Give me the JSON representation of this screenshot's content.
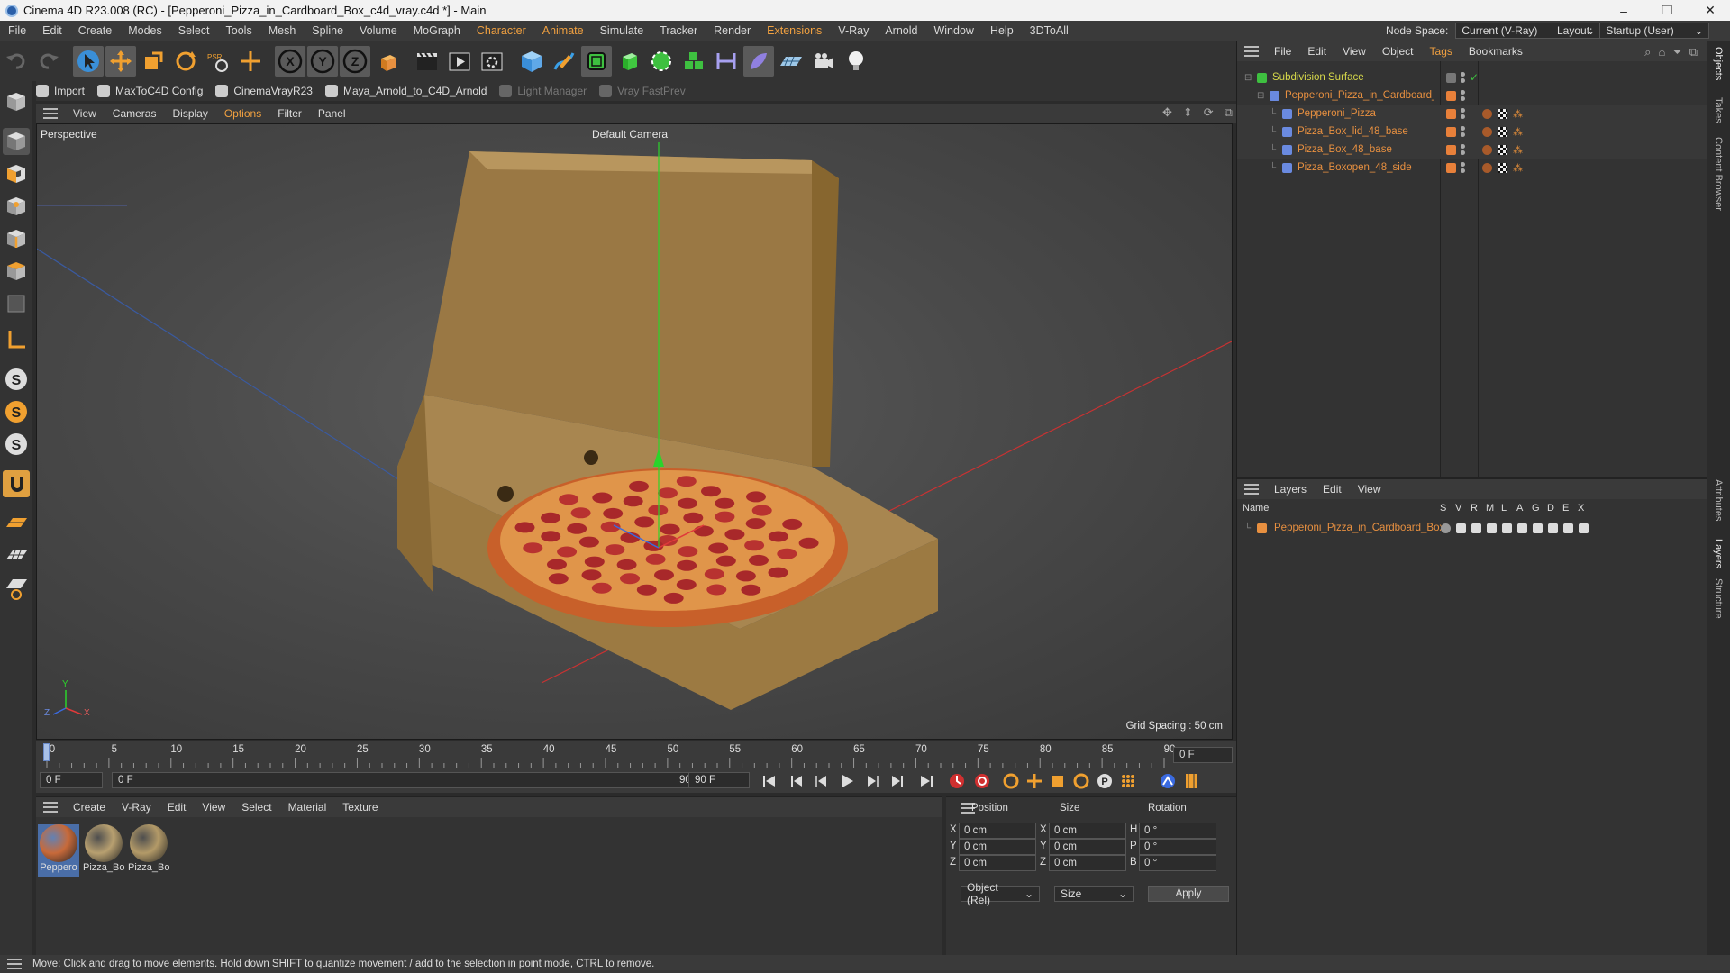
{
  "window": {
    "title": "Cinema 4D R23.008 (RC) - [Pepperoni_Pizza_in_Cardboard_Box_c4d_vray.c4d *] - Main",
    "controls": [
      "–",
      "❐",
      "✕"
    ]
  },
  "menu": [
    "File",
    "Edit",
    "Create",
    "Modes",
    "Select",
    "Tools",
    "Mesh",
    "Spline",
    "Volume",
    "MoGraph",
    "Character",
    "Animate",
    "Simulate",
    "Tracker",
    "Render",
    "Extensions",
    "V-Ray",
    "Arnold",
    "Window",
    "Help",
    "3DToAll"
  ],
  "menu_highlight": [
    "Character",
    "Animate",
    "Extensions"
  ],
  "node_space": {
    "label": "Node Space:",
    "value": "Current (V-Ray)"
  },
  "layout": {
    "label": "Layout:",
    "value": "Startup (User)"
  },
  "plugins": [
    {
      "label": "Import",
      "dim": false
    },
    {
      "label": "MaxToC4D Config",
      "dim": false
    },
    {
      "label": "CinemaVrayR23",
      "dim": false
    },
    {
      "label": "Maya_Arnold_to_C4D_Arnold",
      "dim": false
    },
    {
      "label": "Light Manager",
      "dim": true
    },
    {
      "label": "Vray FastPrev",
      "dim": true
    }
  ],
  "viewport_menu": [
    "View",
    "Cameras",
    "Display",
    "Options",
    "Filter",
    "Panel"
  ],
  "viewport": {
    "name": "Perspective",
    "camera": "Default Camera",
    "grid_spacing": "Grid Spacing : 50 cm",
    "axis_labels": {
      "x": "X",
      "y": "Y",
      "z": "Z"
    }
  },
  "timeline": {
    "ticks": [
      0,
      5,
      10,
      15,
      20,
      25,
      30,
      35,
      40,
      45,
      50,
      55,
      60,
      65,
      70,
      75,
      80,
      85,
      90
    ],
    "max_frame": 90,
    "current": "0 F",
    "end_field": "0 F",
    "start_field": "0 F",
    "range_start": "0 F",
    "range_end": "90 F",
    "range_end_field": "90 F"
  },
  "materials": {
    "menu": [
      "Create",
      "V-Ray",
      "Edit",
      "View",
      "Select",
      "Material",
      "Texture"
    ],
    "items": [
      {
        "label": "Peppero",
        "color": "#c86a3a",
        "selected": true
      },
      {
        "label": "Pizza_Bo",
        "color": "#b8a070",
        "selected": false
      },
      {
        "label": "Pizza_Bo",
        "color": "#b39a68",
        "selected": false
      }
    ]
  },
  "coordinates": {
    "headers": [
      "Position",
      "Size",
      "Rotation"
    ],
    "rows": [
      {
        "axis": "X",
        "pos": "0 cm",
        "size_axis": "X",
        "size": "0 cm",
        "rot_axis": "H",
        "rot": "0 °"
      },
      {
        "axis": "Y",
        "pos": "0 cm",
        "size_axis": "Y",
        "size": "0 cm",
        "rot_axis": "P",
        "rot": "0 °"
      },
      {
        "axis": "Z",
        "pos": "0 cm",
        "size_axis": "Z",
        "size": "0 cm",
        "rot_axis": "B",
        "rot": "0 °"
      }
    ],
    "mode": "Object (Rel)",
    "size_mode": "Size",
    "apply": "Apply"
  },
  "objects": {
    "menu": [
      "File",
      "Edit",
      "View",
      "Object",
      "Tags",
      "Bookmarks"
    ],
    "items": [
      {
        "name": "Subdivision Surface",
        "indent": 0,
        "color": "#d7d94a"
      },
      {
        "name": "Pepperoni_Pizza_in_Cardboard_Box",
        "indent": 1,
        "color": "#e89040"
      },
      {
        "name": "Pepperoni_Pizza",
        "indent": 2,
        "color": "#e89040"
      },
      {
        "name": "Pizza_Box_lid_48_base",
        "indent": 2,
        "color": "#e89040"
      },
      {
        "name": "Pizza_Box_48_base",
        "indent": 2,
        "color": "#e89040"
      },
      {
        "name": "Pizza_Boxopen_48_side",
        "indent": 2,
        "color": "#e89040"
      }
    ]
  },
  "layers": {
    "menu": [
      "Layers",
      "Edit",
      "View"
    ],
    "columns": [
      "Name",
      "S",
      "V",
      "R",
      "M",
      "L",
      "A",
      "G",
      "D",
      "E",
      "X"
    ],
    "items": [
      {
        "name": "Pepperoni_Pizza_in_Cardboard_Box",
        "color": "#e89040"
      }
    ]
  },
  "right_tabs": [
    "Objects",
    "Takes",
    "Content Browser",
    "Attributes",
    "Layers",
    "Structure"
  ],
  "status": "Move: Click and drag to move elements. Hold down SHIFT to quantize movement / add to the selection in point mode, CTRL to remove.",
  "colors": {
    "accent_orange": "#e8903a",
    "selection_blue": "#4a6ea8",
    "grid_red": "#c83232",
    "grid_blue": "#3a5aa0",
    "axis_green": "#2bd42b"
  }
}
